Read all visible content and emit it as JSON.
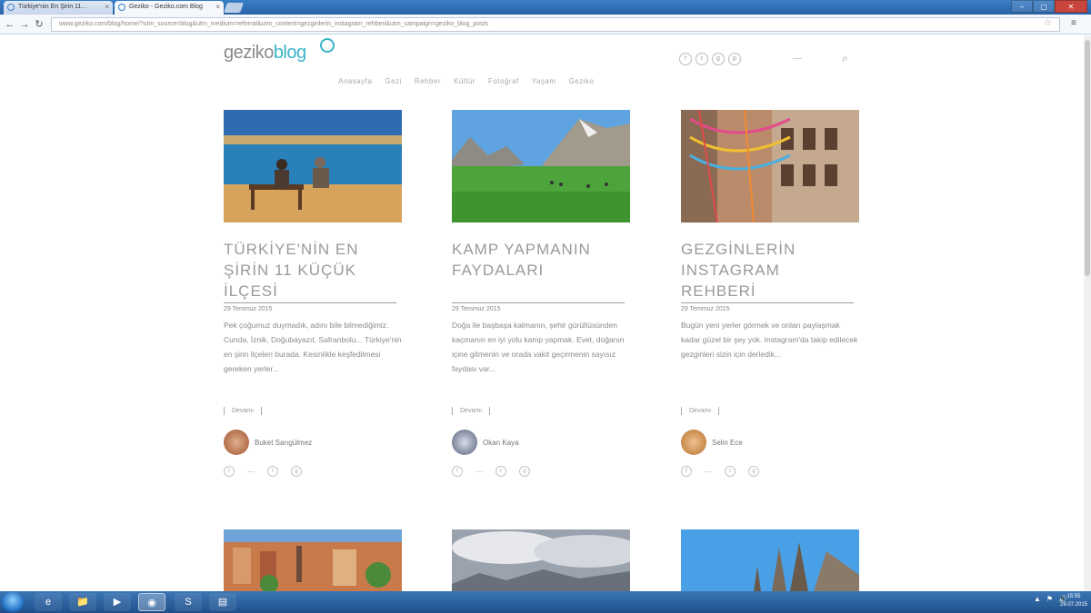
{
  "browser": {
    "tabs": [
      {
        "label": "Türkiye'nin En Şirin 11…",
        "active": false
      },
      {
        "label": "Geziko - Geziko.com Blog",
        "active": true
      }
    ],
    "url": "www.geziko.com/blog/home/?utm_source=blog&utm_medium=referral&utm_content=gezginlerin_instagram_rehberi&utm_campaign=geziko_blog_posts",
    "window_buttons": [
      "–",
      "▢",
      "✕"
    ]
  },
  "site": {
    "logo_part1": "geziko",
    "logo_part2": "blog",
    "nav": [
      "Anasayfa",
      "Gezi",
      "Rehber",
      "Kültür",
      "Fotoğraf",
      "Yaşam",
      "Geziko"
    ],
    "social_icons": [
      "f",
      "t",
      "g",
      "p"
    ]
  },
  "cards": [
    {
      "title": "TÜRKİYE'NİN EN ŞİRİN 11 KÜÇÜK İLÇESİ",
      "date": "29 Temmuz 2015",
      "excerpt": "Pek çoğumuz duymadık, adını bile bilmediğimiz. Cunda, İznik, Doğubayazıt, Safranbolu... Türkiye'nin en şirin ilçeleri burada. Kesinlikle keşfedilmesi gereken yerler...",
      "more_label": "Devamı",
      "author": "Buket Sarıgülmez",
      "avatar_color": "#a0522d"
    },
    {
      "title": "KAMP YAPMANIN FAYDALARI",
      "date": "29 Temmuz 2015",
      "excerpt": "Doğa ile başbaşa kalmanın, şehir gürültüsünden kaçmanın en iyi yolu kamp yapmak. Evet, doğanın içine gitmenin ve orada vakit geçirmenin sayısız faydası var...",
      "more_label": "Devamı",
      "author": "Okan Kaya",
      "avatar_color": "#55607a"
    },
    {
      "title": "GEZGİNLERİN INSTAGRAM REHBERİ",
      "date": "29 Temmuz 2015",
      "excerpt": "Bugün yeni yerler görmek ve onları paylaşmak kadar güzel bir şey yok. Instagram'da takip edilecek gezginleri sizin için derledik...",
      "more_label": "Devamı",
      "author": "Selin Ece",
      "avatar_color": "#b8722e"
    }
  ],
  "share_icons": [
    "f",
    "t",
    "g",
    "p"
  ],
  "taskbar": {
    "apps": [
      "e",
      "📁",
      "▶",
      "◉",
      "S",
      "▤"
    ],
    "time": "15:55",
    "date": "29.07.2015",
    "tray": [
      "▲",
      "⚑",
      "🔊"
    ]
  }
}
